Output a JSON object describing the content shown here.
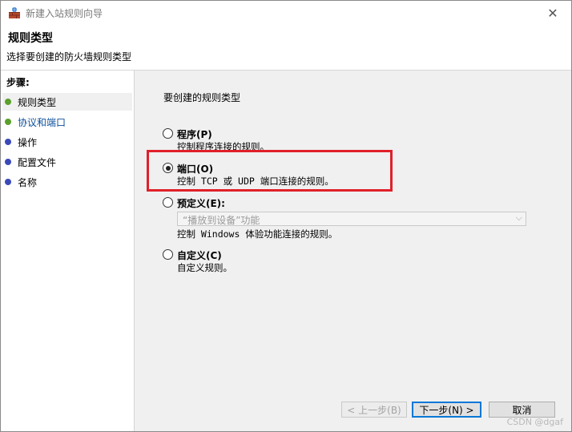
{
  "window": {
    "title": "新建入站规则向导",
    "close_glyph": "✕"
  },
  "header": {
    "title": "规则类型",
    "subtitle": "选择要创建的防火墙规则类型"
  },
  "sidebar": {
    "steps_label": "步骤:",
    "items": [
      {
        "label": "规则类型",
        "dot_color": "#5aa02c"
      },
      {
        "label": "协议和端口",
        "dot_color": "#5aa02c"
      },
      {
        "label": "操作",
        "dot_color": "#3b49b8"
      },
      {
        "label": "配置文件",
        "dot_color": "#3b49b8"
      },
      {
        "label": "名称",
        "dot_color": "#3b49b8"
      }
    ]
  },
  "main": {
    "prompt": "要创建的规则类型",
    "options": [
      {
        "label": "程序(P)",
        "desc": "控制程序连接的规则。",
        "checked": false
      },
      {
        "label": "端口(O)",
        "desc": "控制 TCP 或 UDP 端口连接的规则。",
        "checked": true
      },
      {
        "label": "预定义(E):",
        "desc": "控制 Windows 体验功能连接的规则。",
        "checked": false
      },
      {
        "label": "自定义(C)",
        "desc": "自定义规则。",
        "checked": false
      }
    ],
    "predefined_dropdown": {
      "value": "“播放到设备”功能"
    }
  },
  "buttons": {
    "back": "< 上一步(B)",
    "next": "下一步(N) >",
    "cancel": "取消"
  },
  "watermark": "CSDN @dgaf",
  "colors": {
    "highlight": "#e0202a",
    "step_done": "#5aa02c",
    "step_pending": "#3b49b8"
  }
}
